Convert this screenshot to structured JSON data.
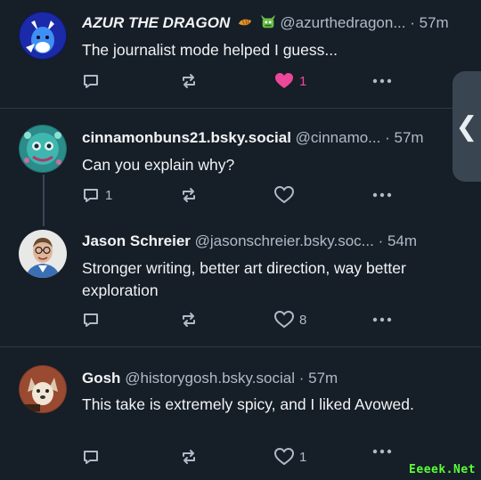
{
  "posts": [
    {
      "name": "AZUR THE DRAGON",
      "name_emojis": [
        "croissant-emoji",
        "dragon-face-emoji"
      ],
      "handle": "@azurthedragon...",
      "separator": "·",
      "time": "57m",
      "text": "The journalist mode helped I guess...",
      "reply_count": "",
      "like_count": "1",
      "liked": true
    },
    {
      "name": "cinnamonbuns21.bsky.social",
      "handle": "@cinnamo...",
      "separator": "·",
      "time": "57m",
      "text": "Can you explain why?",
      "reply_count": "1",
      "like_count": "",
      "liked": false
    },
    {
      "name": "Jason Schreier",
      "handle": "@jasonschreier.bsky.soc...",
      "separator": "·",
      "time": "54m",
      "text": "Stronger writing, better art direction, way better exploration",
      "reply_count": "",
      "like_count": "8",
      "liked": false
    },
    {
      "name": "Gosh",
      "handle": "@historygosh.bsky.social",
      "separator": "·",
      "time": "57m",
      "text": "This take is extremely spicy, and I liked Avowed.",
      "reply_count": "",
      "like_count": "1",
      "liked": false
    }
  ],
  "side_tab": {
    "glyph": "❮"
  },
  "watermark": "Eeeek.Net",
  "colors": {
    "background": "#161e27",
    "secondary_text": "#aebbc9",
    "like_pink": "#ec4899",
    "divider": "#2e3a46"
  }
}
